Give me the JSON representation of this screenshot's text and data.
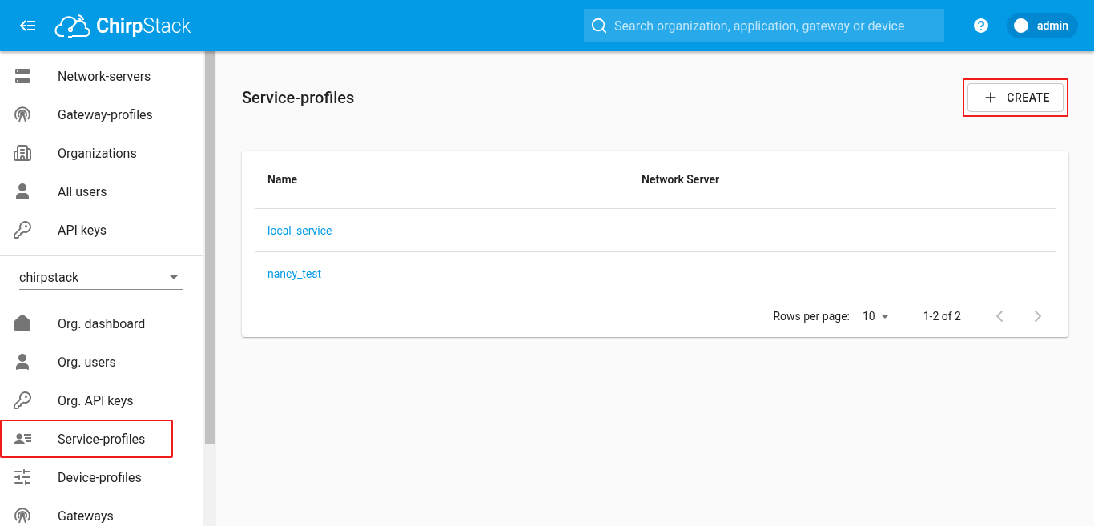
{
  "header": {
    "logo": "**Chirp**Stack",
    "search": {
      "placeholder": "Search organization, application, gateway or device"
    },
    "user": "admin"
  },
  "sidebar": {
    "global_items": [
      {
        "label": "Network-servers",
        "kind": "server",
        "highlighted": false
      },
      {
        "label": "Gateway-profiles",
        "kind": "antenna",
        "highlighted": false
      },
      {
        "label": "Organizations",
        "kind": "building",
        "highlighted": false
      },
      {
        "label": "All users",
        "kind": "person",
        "highlighted": false
      },
      {
        "label": "API keys",
        "kind": "key",
        "highlighted": false
      }
    ],
    "organization_select": "chirpstack",
    "org_items": [
      {
        "label": "Org. dashboard",
        "kind": "home",
        "highlighted": false
      },
      {
        "label": "Org. users",
        "kind": "person",
        "highlighted": false
      },
      {
        "label": "Org. API keys",
        "kind": "key",
        "highlighted": false
      },
      {
        "label": "Service-profiles",
        "kind": "profile",
        "highlighted": true
      },
      {
        "label": "Device-profiles",
        "kind": "sliders",
        "highlighted": false
      },
      {
        "label": "Gateways",
        "kind": "antenna",
        "highlighted": false
      }
    ]
  },
  "page": {
    "title": "Service-profiles",
    "create_button": {
      "label": "CREATE",
      "highlighted": true
    },
    "table": {
      "columns": [
        "Name",
        "Network Server"
      ],
      "rows": [
        {
          "name": "local_service"
        },
        {
          "name": "nancy_test"
        }
      ],
      "pagination": {
        "rows_per_page_label": "Rows per page:",
        "rows_per_page": "10",
        "range": "1-2 of 2"
      }
    }
  }
}
